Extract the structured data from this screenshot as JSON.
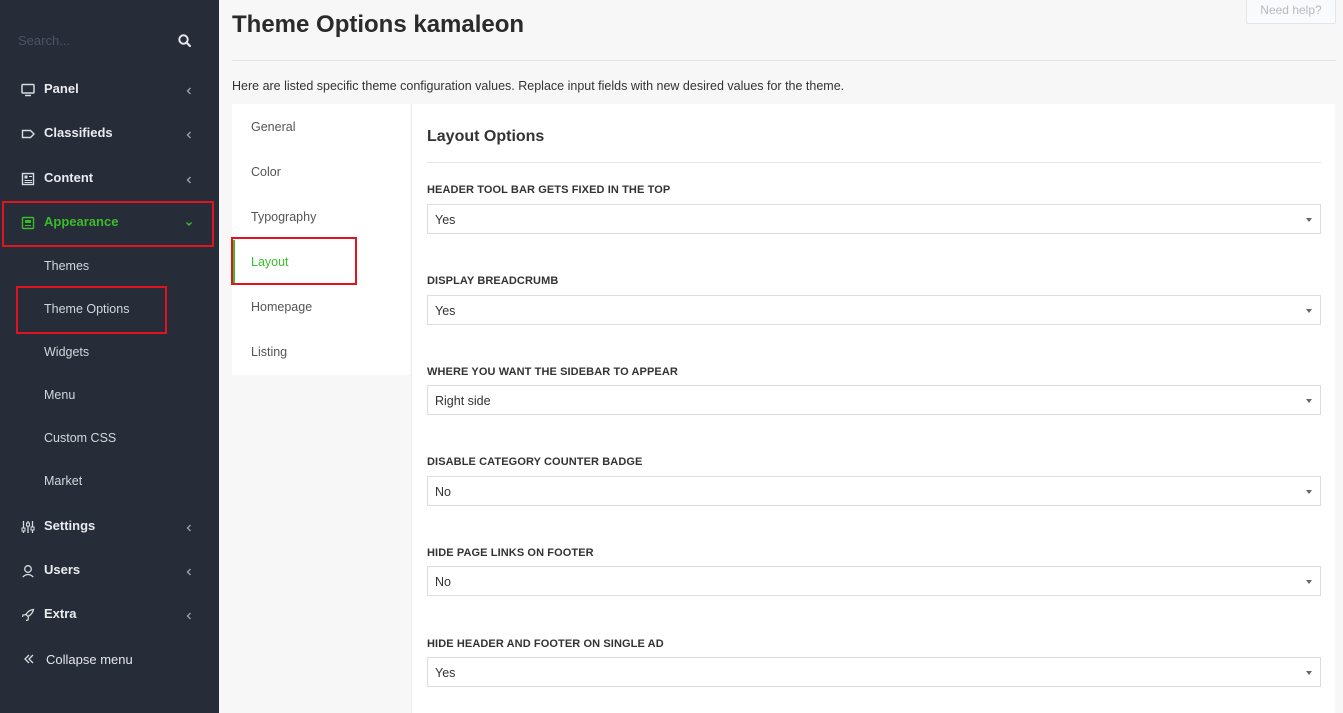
{
  "sidebar": {
    "search_placeholder": "Search...",
    "items": [
      {
        "label": "Panel",
        "icon": "monitor-icon"
      },
      {
        "label": "Classifieds",
        "icon": "tag-icon"
      },
      {
        "label": "Content",
        "icon": "newspaper-icon"
      },
      {
        "label": "Appearance",
        "icon": "palette-icon",
        "expanded": true
      },
      {
        "label": "Settings",
        "icon": "sliders-icon"
      },
      {
        "label": "Users",
        "icon": "user-icon"
      },
      {
        "label": "Extra",
        "icon": "rocket-icon"
      }
    ],
    "appearance_submenu": [
      "Themes",
      "Theme Options",
      "Widgets",
      "Menu",
      "Custom CSS",
      "Market"
    ],
    "collapse_label": "Collapse menu",
    "active_color": "#3bbd2b",
    "highlight_color": "#e0141e"
  },
  "header": {
    "title": "Theme Options kamaleon",
    "help_label": "Need help?",
    "intro": "Here are listed specific theme configuration values. Replace input fields with new desired values for the theme."
  },
  "tabs": [
    "General",
    "Color",
    "Typography",
    "Layout",
    "Homepage",
    "Listing"
  ],
  "active_tab": "Layout",
  "section": {
    "title": "Layout Options",
    "fields": [
      {
        "label": "HEADER TOOL BAR GETS FIXED IN THE TOP",
        "value": "Yes"
      },
      {
        "label": "DISPLAY BREADCRUMB",
        "value": "Yes"
      },
      {
        "label": "WHERE YOU WANT THE SIDEBAR TO APPEAR",
        "value": "Right side"
      },
      {
        "label": "DISABLE CATEGORY COUNTER BADGE",
        "value": "No"
      },
      {
        "label": "HIDE PAGE LINKS ON FOOTER",
        "value": "No"
      },
      {
        "label": "HIDE HEADER AND FOOTER ON SINGLE AD",
        "value": "Yes"
      }
    ]
  }
}
